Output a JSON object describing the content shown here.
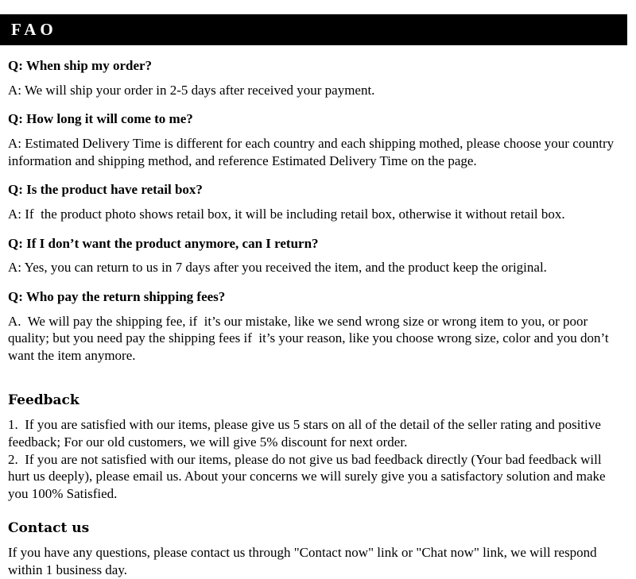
{
  "header": {
    "title": "FAO",
    "background_color": "#000000",
    "text_color": "#ffffff"
  },
  "faq": {
    "items": [
      {
        "question": "Q: When ship my order?",
        "answer": "A: We will ship your order in 2-5 days after received your payment."
      },
      {
        "question": "Q: How long it will come to me?",
        "answer": "A: Estimated Delivery Time is different for each country and each shipping mothed, please choose your country information and shipping method, and reference Estimated Delivery Time on the page."
      },
      {
        "question": "Q: Is the product have retail box?",
        "answer": "A: If  the product photo shows retail box, it will be including retail box, otherwise it without retail box."
      },
      {
        "question": "Q: If I don’t want the product anymore, can I return?",
        "answer": "A: Yes, you can return to us in 7 days after you received the item, and the product keep the original."
      },
      {
        "question": "Q: Who pay the return shipping fees?",
        "answer": "A.  We will pay the shipping fee, if  it’s our mistake, like we send wrong size or wrong item to you, or poor quality; but you need pay the shipping fees if  it’s your reason, like you choose wrong size, color and you don’t want the item anymore."
      }
    ]
  },
  "feedback": {
    "heading": "Feedback",
    "item_1": "1.  If you are satisfied with our items, please give us 5 stars on all of the detail of the seller rating and positive feedback; For our old customers, we will give 5% discount for next order.",
    "item_2": "2.  If you are not satisfied with our items, please do not give us bad feedback directly (Your bad feedback will hurt us deeply), please email us. About your concerns we will surely give you a satisfactory solution and make you 100% Satisfied."
  },
  "contact": {
    "heading": "Contact us",
    "body": "If you have any questions, please contact us through \"Contact now\" link or \"Chat now\" link, we will respond within 1 business day."
  }
}
